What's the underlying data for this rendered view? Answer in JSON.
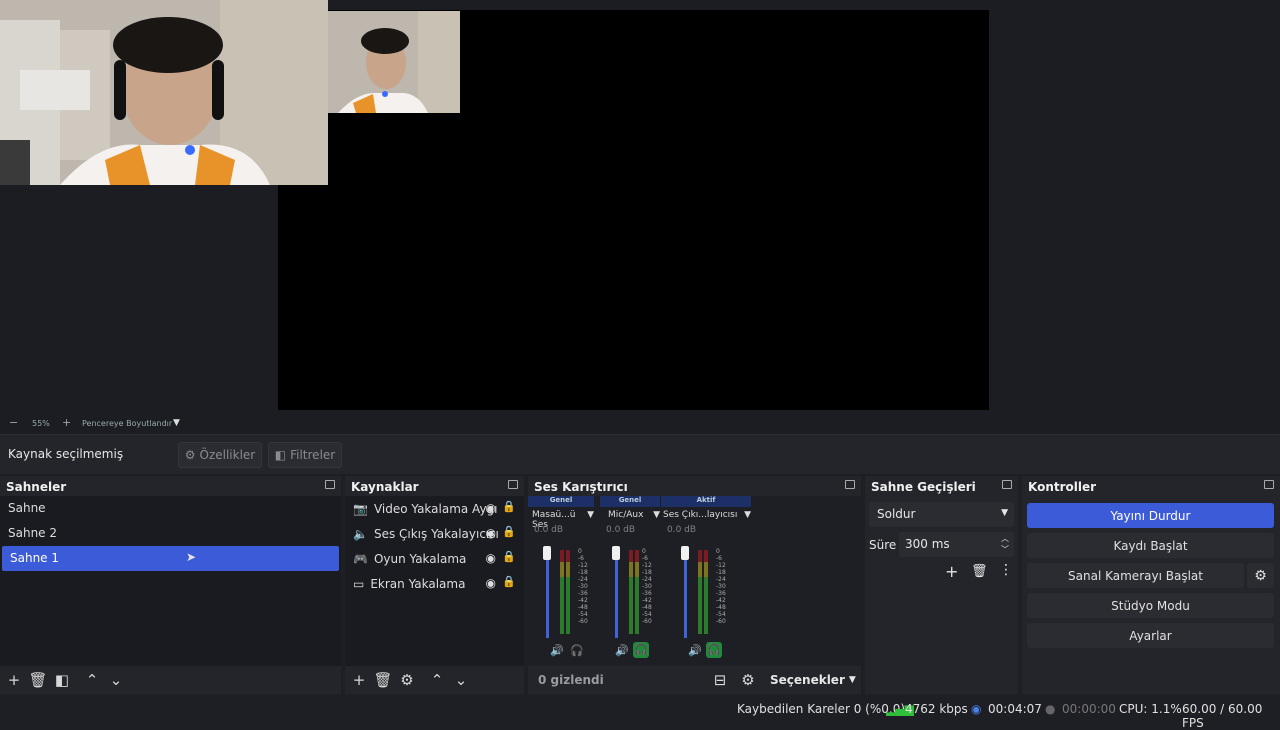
{
  "zoom": {
    "minus": "−",
    "value": "55%",
    "plus": "+",
    "fit_label": "Pencereye Boyutlandır"
  },
  "source_bar": {
    "status": "Kaynak seçilmemiş",
    "properties": "Özellikler",
    "filters": "Filtreler"
  },
  "scenes": {
    "title": "Sahneler",
    "items": [
      "Sahne",
      "Sahne 2",
      "Sahne 1"
    ],
    "selected_index": 2
  },
  "sources": {
    "title": "Kaynaklar",
    "items": [
      {
        "label": "Video Yakalama Aygı",
        "icon": "camera-icon"
      },
      {
        "label": "Ses Çıkış Yakalayıcısı",
        "icon": "speaker-icon"
      },
      {
        "label": "Oyun Yakalama",
        "icon": "gamepad-icon"
      },
      {
        "label": "Ekran Yakalama",
        "icon": "monitor-icon"
      }
    ]
  },
  "mixer": {
    "title": "Ses Karıştırıcı",
    "hidden_label": "0 gizlendi",
    "options_label": "Seçenekler",
    "channels": [
      {
        "tag": "Genel",
        "name": "Masaü...ü Ses",
        "db": "0.0 dB",
        "tag_color": "#1c2f66"
      },
      {
        "tag": "Genel",
        "name": "Mic/Aux",
        "db": "0.0 dB",
        "tag_color": "#1c2f66"
      },
      {
        "tag": "Aktif",
        "name": "Ses Çıkı...layıcısı",
        "db": "0.0 dB",
        "tag_color": "#1c2f66"
      }
    ],
    "scale": [
      "0",
      "-6",
      "-12",
      "-18",
      "-24",
      "-30",
      "-36",
      "-42",
      "-48",
      "-54",
      "-60"
    ]
  },
  "transitions": {
    "title": "Sahne Geçişleri",
    "type": "Soldur",
    "duration_label": "Süre",
    "duration_value": "300 ms"
  },
  "controls": {
    "title": "Kontroller",
    "buttons": [
      "Yayını Durdur",
      "Kaydı Başlat",
      "Sanal Kamerayı Başlat",
      "Stüdyo Modu",
      "Ayarlar"
    ],
    "accent": "#3c5bd8"
  },
  "status": {
    "dropped": "Kaybedilen Kareler 0 (%0.0)",
    "bitrate": "4762 kbps",
    "stream_time": "00:04:07",
    "rec_time": "00:00:00",
    "cpu": "CPU: 1.1%",
    "fps": "60.00 / 60.00 FPS"
  }
}
